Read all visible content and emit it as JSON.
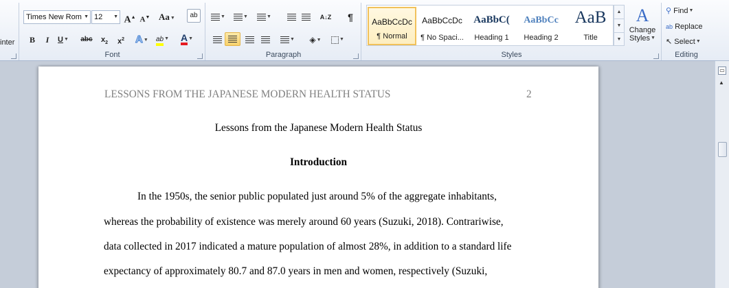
{
  "clipboard": {
    "partial_label": "inter"
  },
  "font": {
    "name": "Times New Rom",
    "size": "12",
    "group_label": "Font",
    "grow": "A",
    "shrink": "A",
    "change_case": "Aa",
    "bold": "B",
    "italic": "I",
    "underline": "U",
    "strike": "abc",
    "subscript": "x",
    "superscript": "x",
    "text_effects": "A",
    "highlight": "ab",
    "font_color": "A",
    "font_color_value": "#e51c23",
    "highlight_color_value": "#ffff00"
  },
  "paragraph": {
    "group_label": "Paragraph",
    "pilcrow": "¶",
    "sort": "A↓Z"
  },
  "styles": {
    "group_label": "Styles",
    "items": [
      {
        "sample": "AaBbCcDc",
        "name": "¶ Normal"
      },
      {
        "sample": "AaBbCcDc",
        "name": "¶ No Spaci..."
      },
      {
        "sample": "AaBbC(",
        "name": "Heading 1"
      },
      {
        "sample": "AaBbCc",
        "name": "Heading 2"
      },
      {
        "sample": "AaB",
        "name": "Title"
      }
    ],
    "change_styles_line1": "Change",
    "change_styles_line2": "Styles",
    "heading_color": "#17365d"
  },
  "editing": {
    "group_label": "Editing",
    "find": "Find",
    "replace": "Replace",
    "select": "Select"
  },
  "document": {
    "running_head": "LESSONS FROM THE JAPANESE MODERN HEALTH STATUS",
    "page_number": "2",
    "title": "Lessons from the Japanese Modern Health Status",
    "section_heading": "Introduction",
    "lines": [
      "In the 1950s, the senior public populated just around 5% of the aggregate inhabitants,",
      "whereas the probability of existence was merely around 60 years (Suzuki, 2018). Contrariwise,",
      "data collected in 2017 indicated a mature population of almost 28%, in addition to a standard life",
      "expectancy of approximately  80.7 and 87.0 years in men and women, respectively (Suzuki,"
    ]
  }
}
